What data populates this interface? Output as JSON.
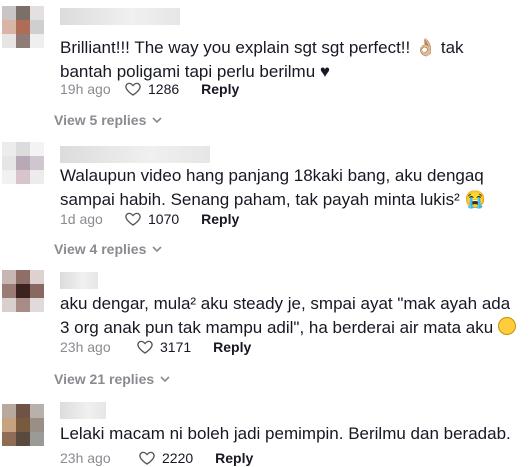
{
  "comments": [
    {
      "text": "Brilliant!!! The way you explain sgt sgt perfect!! 👌🏼 tak bantah poligami tapi perlu berilmu ♥",
      "time": "19h ago",
      "likes": "1286",
      "reply_label": "Reply",
      "replies_label": "View 5 replies",
      "avatar_colors": [
        "#c9c5c5",
        "#7c6f6a",
        "#e4e0e0",
        "#d9b3a4",
        "#b06d55",
        "#cfcfcf",
        "#e7e4e4",
        "#8d7d76",
        "#efefef"
      ]
    },
    {
      "text": "Walaupun video hang panjang 18kaki bang, aku dengaq sampai habih. Senang paham, tak payah minta lukis² 😭",
      "time": "1d ago",
      "likes": "1070",
      "reply_label": "Reply",
      "replies_label": "View 4 replies",
      "avatar_colors": [
        "#ececec",
        "#dcdcdc",
        "#f3f3f3",
        "#e6e6e6",
        "#b8a9b7",
        "#cfc6cf",
        "#f1f1f1",
        "#d7c4cd",
        "#ececec"
      ]
    },
    {
      "text": "aku dengar, mula² aku steady je, smpai ayat \"mak ayah ada 3 org anak pun tak mampu adil\", ha berderai air mata aku",
      "time": "23h ago",
      "likes": "3171",
      "reply_label": "Reply",
      "replies_label": "View 21 replies",
      "avatar_colors": [
        "#c8b6b3",
        "#8e6e67",
        "#ddd2d0",
        "#9b7b75",
        "#3d231f",
        "#8a6862",
        "#d9cfcd",
        "#a88c86",
        "#e2dada"
      ]
    },
    {
      "text": "Lelaki macam ni boleh jadi pemimpin. Berilmu dan beradab.",
      "time": "23h ago",
      "likes": "2220",
      "reply_label": "Reply",
      "replies_label": "",
      "avatar_colors": [
        "#b8a89e",
        "#6e5346",
        "#b7b1ad",
        "#c7a27f",
        "#7a5a3f",
        "#9a8f86",
        "#8e6d54",
        "#5a4a3e",
        "#9a9a96"
      ]
    }
  ]
}
